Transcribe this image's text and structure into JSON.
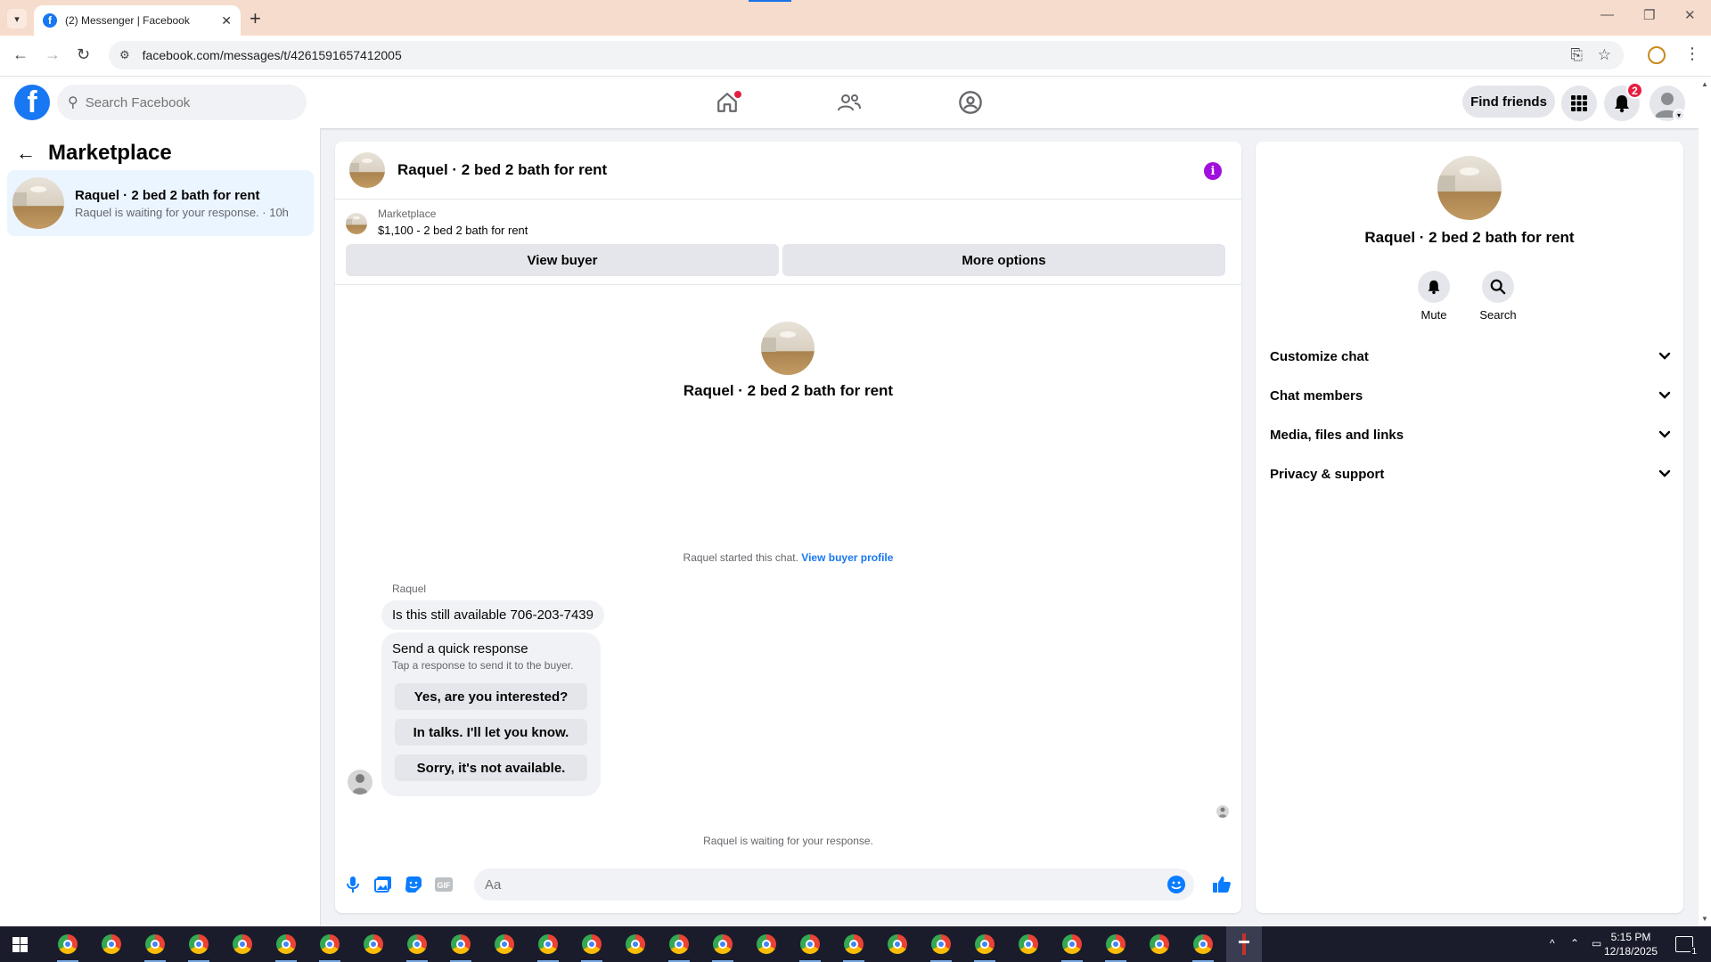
{
  "browser": {
    "tab_title": "(2) Messenger | Facebook",
    "url": "facebook.com/messages/t/4261591657412005"
  },
  "fb": {
    "search_placeholder": "Search Facebook",
    "find_friends": "Find friends",
    "notification_count": "2"
  },
  "left": {
    "title": "Marketplace",
    "conversation": {
      "name": "Raquel · 2 bed 2 bath for rent",
      "preview": "Raquel is waiting for your response. · 10h"
    }
  },
  "chat": {
    "header_name": "Raquel · 2 bed 2 bath for rent",
    "listing_source": "Marketplace",
    "listing_title": "$1,100 - 2 bed 2 bath for rent",
    "view_buyer": "View buyer",
    "more_options": "More options",
    "center_name": "Raquel · 2 bed 2 bath for rent",
    "started_text": "Raquel started this chat.",
    "view_buyer_profile": "View buyer profile",
    "sender": "Raquel",
    "message": "Is this still available 706-203-7439",
    "quick_title": "Send a quick response",
    "quick_sub": "Tap a response to send it to the buyer.",
    "quick_responses": [
      "Yes, are you interested?",
      "In talks. I'll let you know.",
      "Sorry, it's not available."
    ],
    "waiting": "Raquel is waiting for your response.",
    "composer_placeholder": "Aa"
  },
  "right": {
    "name": "Raquel · 2 bed 2 bath for rent",
    "mute": "Mute",
    "search": "Search",
    "sections": [
      "Customize chat",
      "Chat members",
      "Media, files and links",
      "Privacy & support"
    ]
  },
  "taskbar": {
    "time": "5:15 PM",
    "date": "12/18/2025",
    "notif_count": "1"
  },
  "colors": {
    "fb_blue": "#1877f2",
    "info_purple": "#a10fdc",
    "badge_red": "#e41e3f"
  }
}
